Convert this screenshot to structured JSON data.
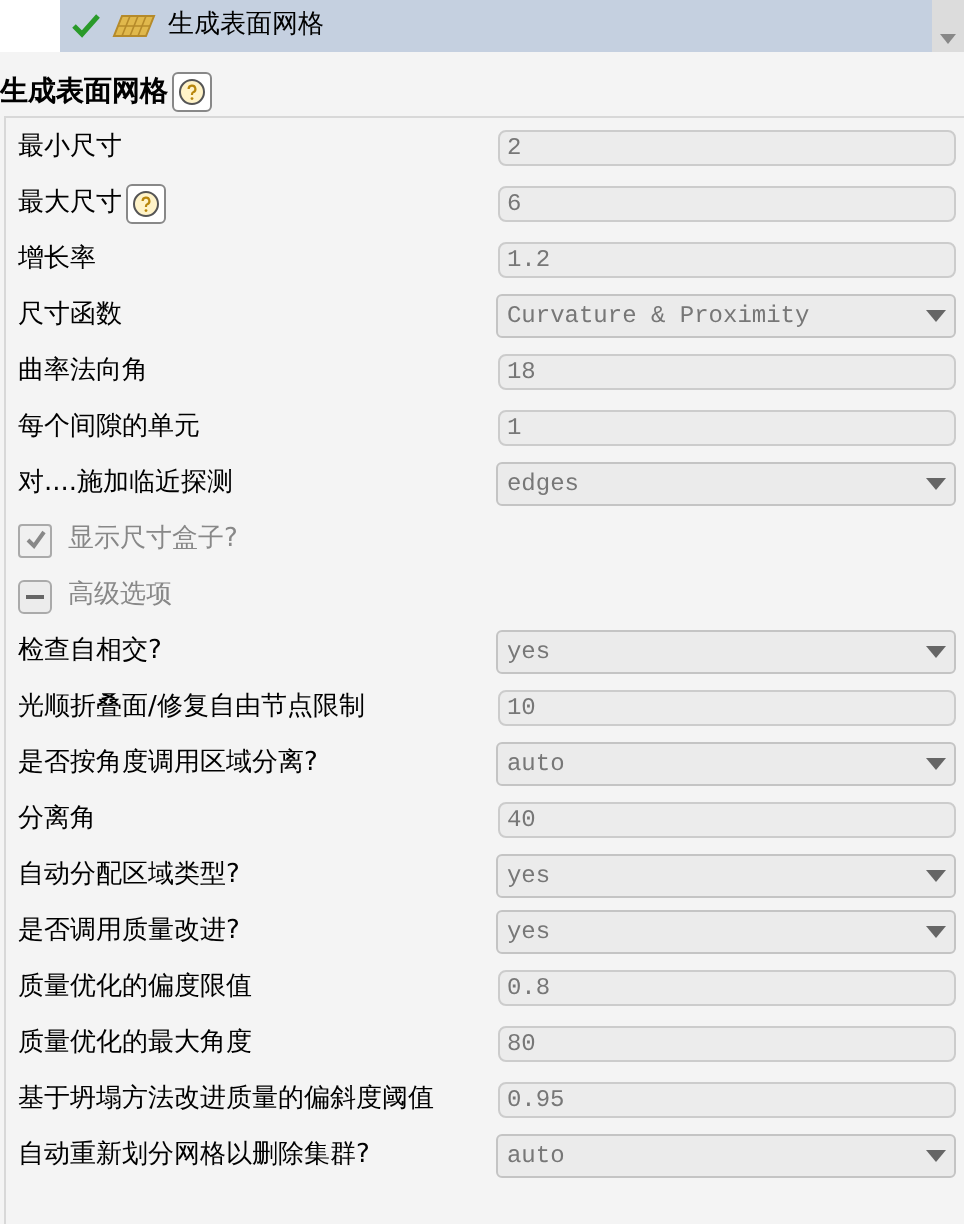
{
  "tree_item": {
    "label": "生成表面网格"
  },
  "panel": {
    "title": "生成表面网格"
  },
  "rows": [
    {
      "kind": "text",
      "label": "最小尺寸",
      "value": "2"
    },
    {
      "kind": "text",
      "label": "最大尺寸",
      "value": "6",
      "help": true
    },
    {
      "kind": "text",
      "label": "增长率",
      "value": "1.2"
    },
    {
      "kind": "combo",
      "label": "尺寸函数",
      "value": "Curvature & Proximity"
    },
    {
      "kind": "text",
      "label": "曲率法向角",
      "value": "18"
    },
    {
      "kind": "text",
      "label": "每个间隙的单元",
      "value": "1"
    },
    {
      "kind": "combo",
      "label": "对....施加临近探测",
      "value": "edges"
    },
    {
      "kind": "checkbox",
      "label": "显示尺寸盒子?",
      "checked": true
    },
    {
      "kind": "section",
      "label": "高级选项",
      "expanded": true
    },
    {
      "kind": "combo",
      "label": "检查自相交?",
      "value": "yes"
    },
    {
      "kind": "text",
      "label": "光顺折叠面/修复自由节点限制",
      "value": "10"
    },
    {
      "kind": "combo",
      "label": "是否按角度调用区域分离?",
      "value": "auto"
    },
    {
      "kind": "text",
      "label": "分离角",
      "value": "40"
    },
    {
      "kind": "combo",
      "label": "自动分配区域类型?",
      "value": "yes"
    },
    {
      "kind": "combo",
      "label": "是否调用质量改进?",
      "value": "yes"
    },
    {
      "kind": "text",
      "label": "质量优化的偏度限值",
      "value": "0.8"
    },
    {
      "kind": "text",
      "label": "质量优化的最大角度",
      "value": "80"
    },
    {
      "kind": "text",
      "label": "基于坍塌方法改进质量的偏斜度阈值",
      "value": "0.95"
    },
    {
      "kind": "combo",
      "label": "自动重新划分网格以删除集群?",
      "value": "auto"
    }
  ]
}
